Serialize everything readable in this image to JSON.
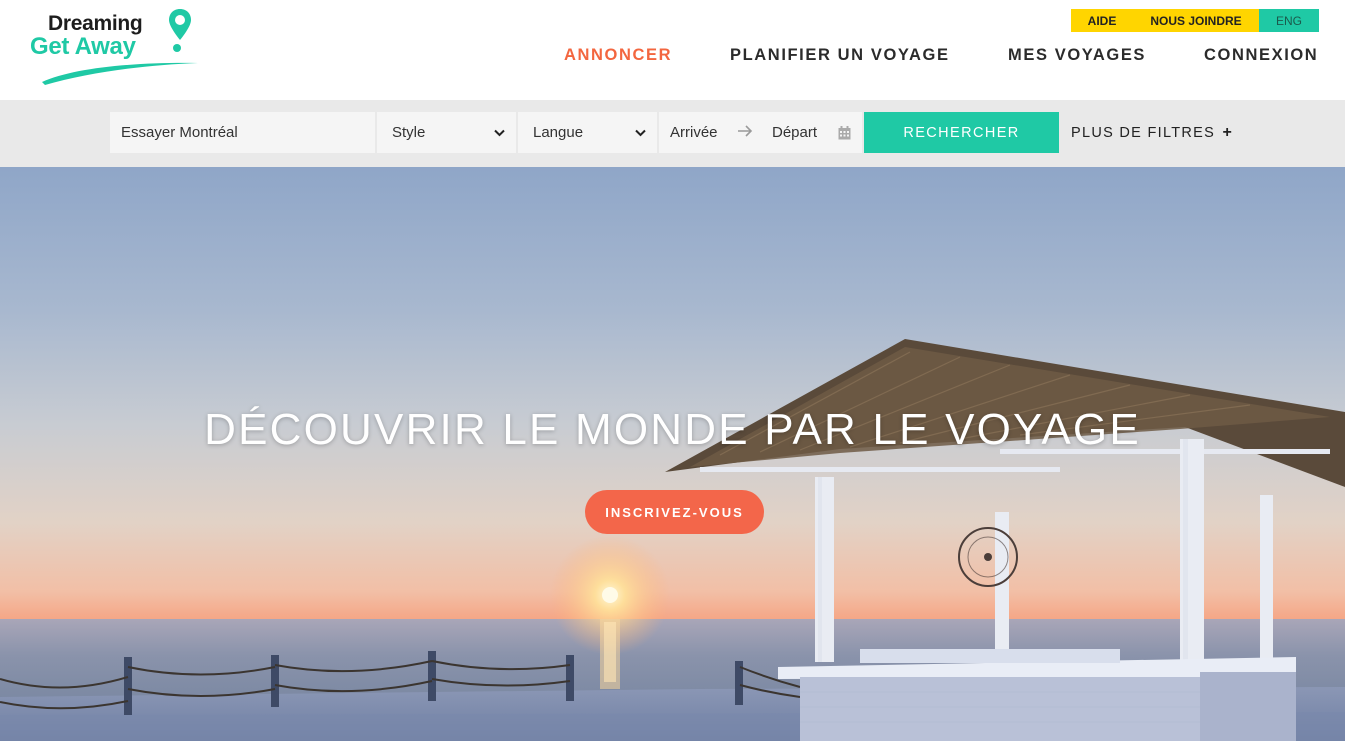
{
  "brand": {
    "line1": "Dreaming",
    "line2": "Get Away"
  },
  "utility_nav": {
    "help": "AIDE",
    "contact": "NOUS JOINDRE",
    "language": "ENG"
  },
  "main_nav": [
    {
      "label": "ANNONCER",
      "active": true
    },
    {
      "label": "PLANIFIER UN VOYAGE"
    },
    {
      "label": "MES VOYAGES"
    },
    {
      "label": "CONNEXION"
    }
  ],
  "search": {
    "destination_placeholder": "Essayer Montréal",
    "style_label": "Style",
    "language_label": "Langue",
    "arrival_label": "Arrivée",
    "departure_label": "Départ",
    "submit_label": "RECHERCHER",
    "more_filters_label": "PLUS DE FILTRES",
    "more_filters_icon": "+"
  },
  "hero": {
    "title": "DÉCOUVRIR LE MONDE PAR LE VOYAGE",
    "cta_label": "INSCRIVEZ-VOUS"
  },
  "colors": {
    "accent_teal": "#1fc9a5",
    "accent_orange": "#f3663f",
    "utility_yellow": "#ffd500",
    "searchbar_bg": "#e9e9e9"
  },
  "icons": {
    "logo_pin": "map-pin-icon",
    "select_chevron": "chevron-down-icon",
    "date_arrow": "arrow-right-icon",
    "calendar": "calendar-icon"
  }
}
